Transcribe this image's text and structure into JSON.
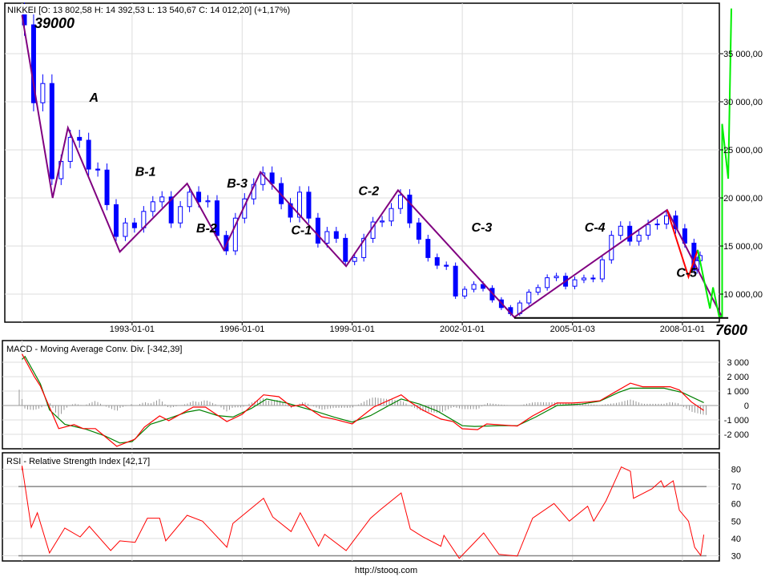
{
  "header": {
    "title": "NIKKEI [O: 13 802,58  H: 14 392,53  L: 13 540,67  C: 14 012,20] (+1,17%)"
  },
  "footer": {
    "source": "http://stooq.com"
  },
  "colors": {
    "candle": "#0000ff",
    "wave": "#800080",
    "projection": "#00ee00",
    "recent": "#ff0000",
    "macd": "#ff0000",
    "signal": "#008000",
    "histogram": "#999999",
    "rsi": "#ff0000",
    "grid": "#dddddd"
  },
  "chart_data": [
    {
      "type": "candlestick",
      "title": "NIKKEI [O: 13 802,58  H: 14 392,53  L: 13 540,67  C: 14 012,20] (+1,17%)",
      "ylim": [
        7600,
        40000
      ],
      "grid": true,
      "y_ticks": [
        "35 000,00",
        "30 000,00",
        "25 000,00",
        "20 000,00",
        "15 000,00",
        "10 000,00"
      ],
      "y_tick_values": [
        35000,
        30000,
        25000,
        20000,
        15000,
        10000
      ],
      "x_ticks": [
        "1993-01-01",
        "1996-01-01",
        "1999-01-01",
        "2002-01-01",
        "2005-01-03",
        "2008-01-01"
      ],
      "closes": [
        [
          "1990-01",
          38000
        ],
        [
          "1990-04",
          29900
        ],
        [
          "1990-07",
          31900
        ],
        [
          "1990-10",
          22000
        ],
        [
          "1991-01",
          23800
        ],
        [
          "1991-04",
          26300
        ],
        [
          "1991-07",
          26000
        ],
        [
          "1991-10",
          23000
        ],
        [
          "1992-01",
          22900
        ],
        [
          "1992-04",
          19300
        ],
        [
          "1992-07",
          16000
        ],
        [
          "1992-10",
          17400
        ],
        [
          "1993-01",
          16900
        ],
        [
          "1993-04",
          18600
        ],
        [
          "1993-07",
          19600
        ],
        [
          "1993-10",
          20100
        ],
        [
          "1994-01",
          17400
        ],
        [
          "1994-04",
          19100
        ],
        [
          "1994-07",
          20600
        ],
        [
          "1994-10",
          19600
        ],
        [
          "1995-01",
          19700
        ],
        [
          "1995-04",
          16100
        ],
        [
          "1995-07",
          14500
        ],
        [
          "1995-10",
          17900
        ],
        [
          "1996-01",
          19900
        ],
        [
          "1996-04",
          21400
        ],
        [
          "1996-07",
          22600
        ],
        [
          "1996-10",
          21500
        ],
        [
          "1997-01",
          19400
        ],
        [
          "1997-04",
          18000
        ],
        [
          "1997-07",
          20600
        ],
        [
          "1997-10",
          17900
        ],
        [
          "1998-01",
          15300
        ],
        [
          "1998-04",
          16500
        ],
        [
          "1998-07",
          15800
        ],
        [
          "1998-10",
          13400
        ],
        [
          "1999-01",
          13800
        ],
        [
          "1999-04",
          15800
        ],
        [
          "1999-07",
          17500
        ],
        [
          "1999-10",
          17600
        ],
        [
          "2000-01",
          18900
        ],
        [
          "2000-04",
          20300
        ],
        [
          "2000-07",
          17400
        ],
        [
          "2000-10",
          15700
        ],
        [
          "2001-01",
          13800
        ],
        [
          "2001-04",
          13000
        ],
        [
          "2001-07",
          12900
        ],
        [
          "2001-10",
          9800
        ],
        [
          "2002-01",
          10500
        ],
        [
          "2002-04",
          11000
        ],
        [
          "2002-07",
          10600
        ],
        [
          "2002-10",
          9400
        ],
        [
          "2003-01",
          8600
        ],
        [
          "2003-04",
          7970
        ],
        [
          "2003-07",
          9080
        ],
        [
          "2003-10",
          10200
        ],
        [
          "2004-01",
          10680
        ],
        [
          "2004-04",
          11700
        ],
        [
          "2004-07",
          11860
        ],
        [
          "2004-10",
          10820
        ],
        [
          "2005-01",
          11490
        ],
        [
          "2005-04",
          11670
        ],
        [
          "2005-07",
          11580
        ],
        [
          "2005-10",
          13570
        ],
        [
          "2006-01",
          16110
        ],
        [
          "2006-04",
          17060
        ],
        [
          "2006-07",
          15500
        ],
        [
          "2006-10",
          16130
        ],
        [
          "2007-01",
          17220
        ],
        [
          "2007-04",
          17290
        ],
        [
          "2007-07",
          18140
        ],
        [
          "2007-10",
          16790
        ],
        [
          "2008-01",
          15300
        ],
        [
          "2008-04",
          12500
        ],
        [
          "2008-05",
          13480
        ],
        [
          "2008-06",
          14012
        ]
      ],
      "wave_line": [
        [
          "1990-01",
          39000
        ],
        [
          "1990-11",
          20000
        ],
        [
          "1991-04",
          27300
        ],
        [
          "1992-09",
          14400
        ],
        [
          "1994-07",
          21500
        ],
        [
          "1995-07",
          14600
        ],
        [
          "1996-07",
          22700
        ],
        [
          "1998-11",
          12900
        ],
        [
          "2000-04",
          20800
        ],
        [
          "2003-06",
          7600
        ],
        [
          "2007-08",
          18750
        ],
        [
          "2009-02",
          7600
        ]
      ],
      "recent_line": [
        [
          "2007-08",
          18750
        ],
        [
          "2008-03",
          11800
        ],
        [
          "2008-06",
          14600
        ]
      ],
      "projection_line": [
        [
          "2008-06",
          14600
        ],
        [
          "2008-10",
          8500
        ],
        [
          "2008-11",
          10700
        ],
        [
          "2009-01",
          7700
        ],
        [
          "2009-02",
          7700
        ],
        [
          "2009-02",
          27700
        ],
        [
          "2009-04",
          22000
        ],
        [
          "2009-05",
          39700
        ]
      ],
      "support_line": {
        "from": "2003-06",
        "to": "2009-04",
        "value": 7600
      },
      "annotations": {
        "top": "39000",
        "bottom": "7600",
        "waves": [
          {
            "label": "A",
            "date": "1991-11",
            "value": 30000
          },
          {
            "label": "B-1",
            "date": "1993-02",
            "value": 22300
          },
          {
            "label": "B-2",
            "date": "1994-10",
            "value": 16400
          },
          {
            "label": "B-3",
            "date": "1995-08",
            "value": 21100
          },
          {
            "label": "C-1",
            "date": "1997-05",
            "value": 16200
          },
          {
            "label": "C-2",
            "date": "1999-03",
            "value": 20300
          },
          {
            "label": "C-3",
            "date": "2002-04",
            "value": 16500
          },
          {
            "label": "C-4",
            "date": "2005-05",
            "value": 16500
          },
          {
            "label": "C-5",
            "date": "2007-11",
            "value": 11800
          }
        ]
      }
    },
    {
      "type": "line",
      "title": "MACD - Moving Average Conv. Div. [-342,39]",
      "ylim": [
        -3200,
        4500
      ],
      "grid": true,
      "y_ticks": [
        "3 000",
        "2 000",
        "1 000",
        "0",
        "-1 000",
        "-2 000"
      ],
      "y_tick_values": [
        3000,
        2000,
        1000,
        0,
        -1000,
        -2000
      ],
      "series": [
        {
          "key": "macd",
          "points": [
            [
              "1990-01",
              3570
            ],
            [
              "1990-05",
              2000
            ],
            [
              "1990-07",
              1350
            ],
            [
              "1991-01",
              -1600
            ],
            [
              "1991-06",
              -1330
            ],
            [
              "1991-09",
              -1600
            ],
            [
              "1992-01",
              -1600
            ],
            [
              "1992-08",
              -2830
            ],
            [
              "1993-02",
              -2330
            ],
            [
              "1993-05",
              -1500
            ],
            [
              "1993-10",
              -720
            ],
            [
              "1994-01",
              -1050
            ],
            [
              "1994-09",
              -110
            ],
            [
              "1995-01",
              -110
            ],
            [
              "1995-08",
              -1110
            ],
            [
              "1996-01",
              -610
            ],
            [
              "1996-08",
              740
            ],
            [
              "1997-01",
              610
            ],
            [
              "1997-05",
              -60
            ],
            [
              "1997-09",
              60
            ],
            [
              "1998-03",
              -780
            ],
            [
              "1998-07",
              -940
            ],
            [
              "1999-01",
              -1280
            ],
            [
              "1999-08",
              -110
            ],
            [
              "2000-05",
              740
            ],
            [
              "2000-08",
              240
            ],
            [
              "2000-12",
              -310
            ],
            [
              "2001-06",
              -940
            ],
            [
              "2001-10",
              -1110
            ],
            [
              "2002-01",
              -1610
            ],
            [
              "2002-06",
              -1670
            ],
            [
              "2002-09",
              -1280
            ],
            [
              "2003-07",
              -1420
            ],
            [
              "2003-12",
              -720
            ],
            [
              "2004-08",
              180
            ],
            [
              "2005-01",
              170
            ],
            [
              "2005-06",
              240
            ],
            [
              "2005-10",
              330
            ],
            [
              "2006-08",
              1550
            ],
            [
              "2006-12",
              1300
            ],
            [
              "2007-09",
              1300
            ],
            [
              "2007-12",
              1070
            ],
            [
              "2008-04",
              240
            ],
            [
              "2008-08",
              -342
            ]
          ]
        },
        {
          "key": "signal",
          "points": [
            [
              "1990-01",
              3200
            ],
            [
              "1990-02",
              3400
            ],
            [
              "1990-07",
              1500
            ],
            [
              "1990-10",
              -300
            ],
            [
              "1991-03",
              -1300
            ],
            [
              "1991-10",
              -1650
            ],
            [
              "1992-04",
              -2100
            ],
            [
              "1992-09",
              -2600
            ],
            [
              "1993-01",
              -2500
            ],
            [
              "1993-07",
              -1300
            ],
            [
              "1994-01",
              -900
            ],
            [
              "1994-07",
              -450
            ],
            [
              "1994-11",
              -300
            ],
            [
              "1995-05",
              -700
            ],
            [
              "1995-10",
              -800
            ],
            [
              "1996-04",
              -200
            ],
            [
              "1996-09",
              450
            ],
            [
              "1997-04",
              150
            ],
            [
              "1997-08",
              -100
            ],
            [
              "1998-01",
              -400
            ],
            [
              "1998-07",
              -800
            ],
            [
              "1999-01",
              -1150
            ],
            [
              "1999-07",
              -700
            ],
            [
              "2000-01",
              0
            ],
            [
              "2000-05",
              450
            ],
            [
              "2000-11",
              100
            ],
            [
              "2001-05",
              -400
            ],
            [
              "2002-01",
              -1400
            ],
            [
              "2002-05",
              -1450
            ],
            [
              "2003-01",
              -1400
            ],
            [
              "2003-07",
              -1400
            ],
            [
              "2004-01",
              -800
            ],
            [
              "2004-08",
              0
            ],
            [
              "2005-04",
              100
            ],
            [
              "2005-10",
              300
            ],
            [
              "2006-04",
              900
            ],
            [
              "2006-08",
              1200
            ],
            [
              "2007-07",
              1200
            ],
            [
              "2008-01",
              900
            ],
            [
              "2008-08",
              200
            ]
          ]
        }
      ]
    },
    {
      "type": "line",
      "title": "RSI - Relative Strength Index [42,17]",
      "ylim": [
        27,
        88
      ],
      "grid": true,
      "y_ticks": [
        "80",
        "70",
        "60",
        "50",
        "40",
        "30"
      ],
      "y_tick_values": [
        80,
        70,
        60,
        50,
        40,
        30
      ],
      "levels": [
        70,
        30
      ],
      "series": [
        {
          "key": "rsi",
          "points": [
            [
              "1990-01",
              79.5
            ],
            [
              "1990-01",
              82
            ],
            [
              "1990-04",
              46.4
            ],
            [
              "1990-06",
              54.8
            ],
            [
              "1990-10",
              31.6
            ],
            [
              "1991-03",
              46
            ],
            [
              "1991-08",
              40.9
            ],
            [
              "1991-11",
              47
            ],
            [
              "1992-06",
              33
            ],
            [
              "1992-09",
              38.6
            ],
            [
              "1993-02",
              37.8
            ],
            [
              "1993-06",
              51.7
            ],
            [
              "1993-10",
              51.7
            ],
            [
              "1993-12",
              38.6
            ],
            [
              "1994-07",
              53.4
            ],
            [
              "1994-12",
              50
            ],
            [
              "1995-08",
              34.9
            ],
            [
              "1995-10",
              48.7
            ],
            [
              "1996-08",
              63.2
            ],
            [
              "1996-11",
              52.4
            ],
            [
              "1997-05",
              44
            ],
            [
              "1997-08",
              54.8
            ],
            [
              "1998-02",
              35.5
            ],
            [
              "1998-04",
              42.4
            ],
            [
              "1998-11",
              33
            ],
            [
              "1999-07",
              51.7
            ],
            [
              "1999-10",
              56.3
            ],
            [
              "2000-05",
              66.3
            ],
            [
              "2000-08",
              45.5
            ],
            [
              "2000-12",
              41
            ],
            [
              "2001-06",
              35.5
            ],
            [
              "2001-07",
              41.8
            ],
            [
              "2001-12",
              28.5
            ],
            [
              "2002-03",
              34
            ],
            [
              "2002-08",
              43.2
            ],
            [
              "2003-01",
              30.8
            ],
            [
              "2003-07",
              29.8
            ],
            [
              "2003-12",
              51.7
            ],
            [
              "2004-07",
              60.2
            ],
            [
              "2004-12",
              50
            ],
            [
              "2005-06",
              58.6
            ],
            [
              "2005-08",
              50
            ],
            [
              "2005-12",
              61.7
            ],
            [
              "2006-05",
              81.3
            ],
            [
              "2006-08",
              78.8
            ],
            [
              "2006-09",
              63.2
            ],
            [
              "2007-03",
              68.6
            ],
            [
              "2007-06",
              73.3
            ],
            [
              "2007-07",
              69.6
            ],
            [
              "2007-10",
              73.3
            ],
            [
              "2007-12",
              56.3
            ],
            [
              "2008-03",
              50
            ],
            [
              "2008-05",
              34.9
            ],
            [
              "2008-07",
              30.2
            ],
            [
              "2008-08",
              42.17
            ]
          ]
        }
      ]
    }
  ]
}
